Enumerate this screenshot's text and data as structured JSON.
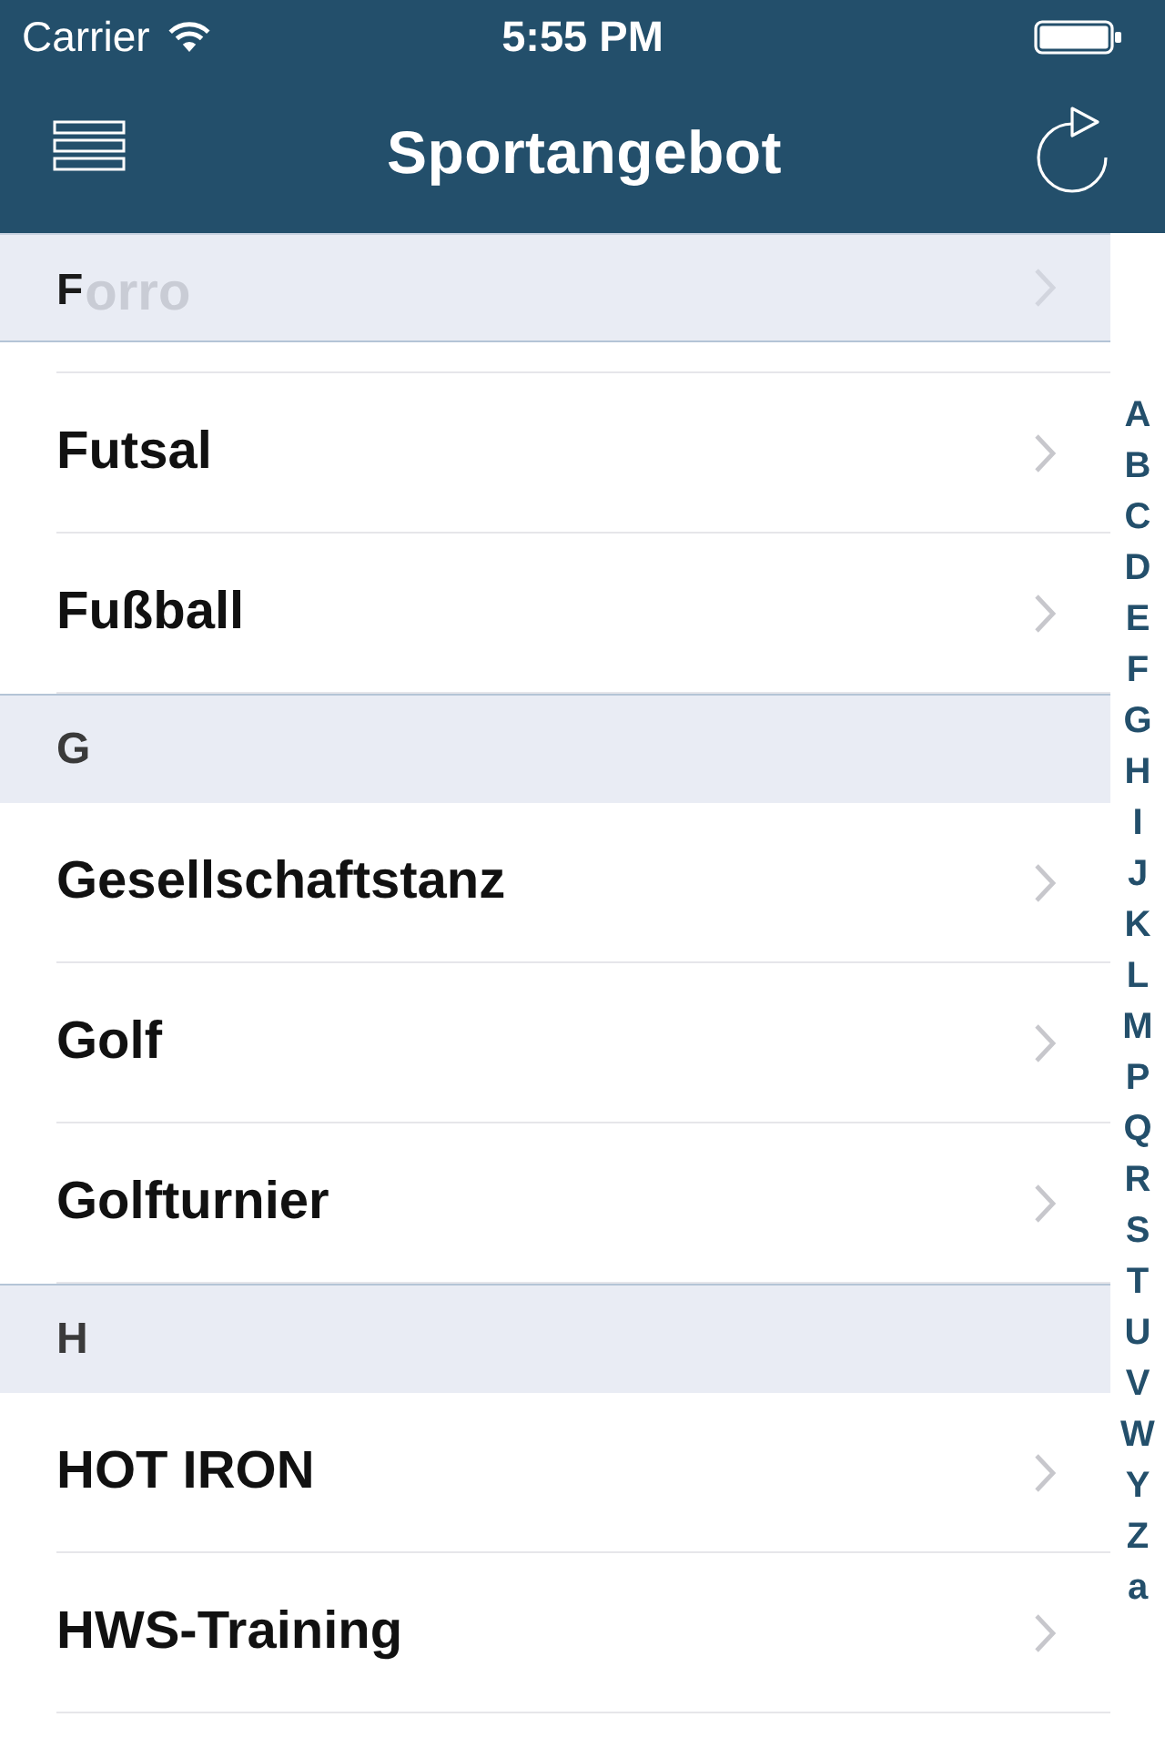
{
  "status_bar": {
    "carrier": "Carrier",
    "time": "5:55 PM"
  },
  "nav_bar": {
    "title": "Sportangebot"
  },
  "sections": [
    {
      "header": "F",
      "items": [
        {
          "kind": "covered",
          "label": "orro"
        },
        {
          "kind": "row",
          "label": "Futsal"
        },
        {
          "kind": "row",
          "label": "Fußball"
        }
      ]
    },
    {
      "header": "G",
      "items": [
        {
          "kind": "row",
          "label": "Gesellschaftstanz"
        },
        {
          "kind": "row",
          "label": "Golf"
        },
        {
          "kind": "row",
          "label": "Golfturnier"
        }
      ]
    },
    {
      "header": "H",
      "items": [
        {
          "kind": "row",
          "label": "HOT IRON"
        },
        {
          "kind": "row",
          "label": "HWS-Training"
        }
      ]
    }
  ],
  "index": [
    "A",
    "B",
    "C",
    "D",
    "E",
    "F",
    "G",
    "H",
    "I",
    "J",
    "K",
    "L",
    "M",
    "P",
    "Q",
    "R",
    "S",
    "T",
    "U",
    "V",
    "W",
    "Y",
    "Z",
    "a"
  ]
}
